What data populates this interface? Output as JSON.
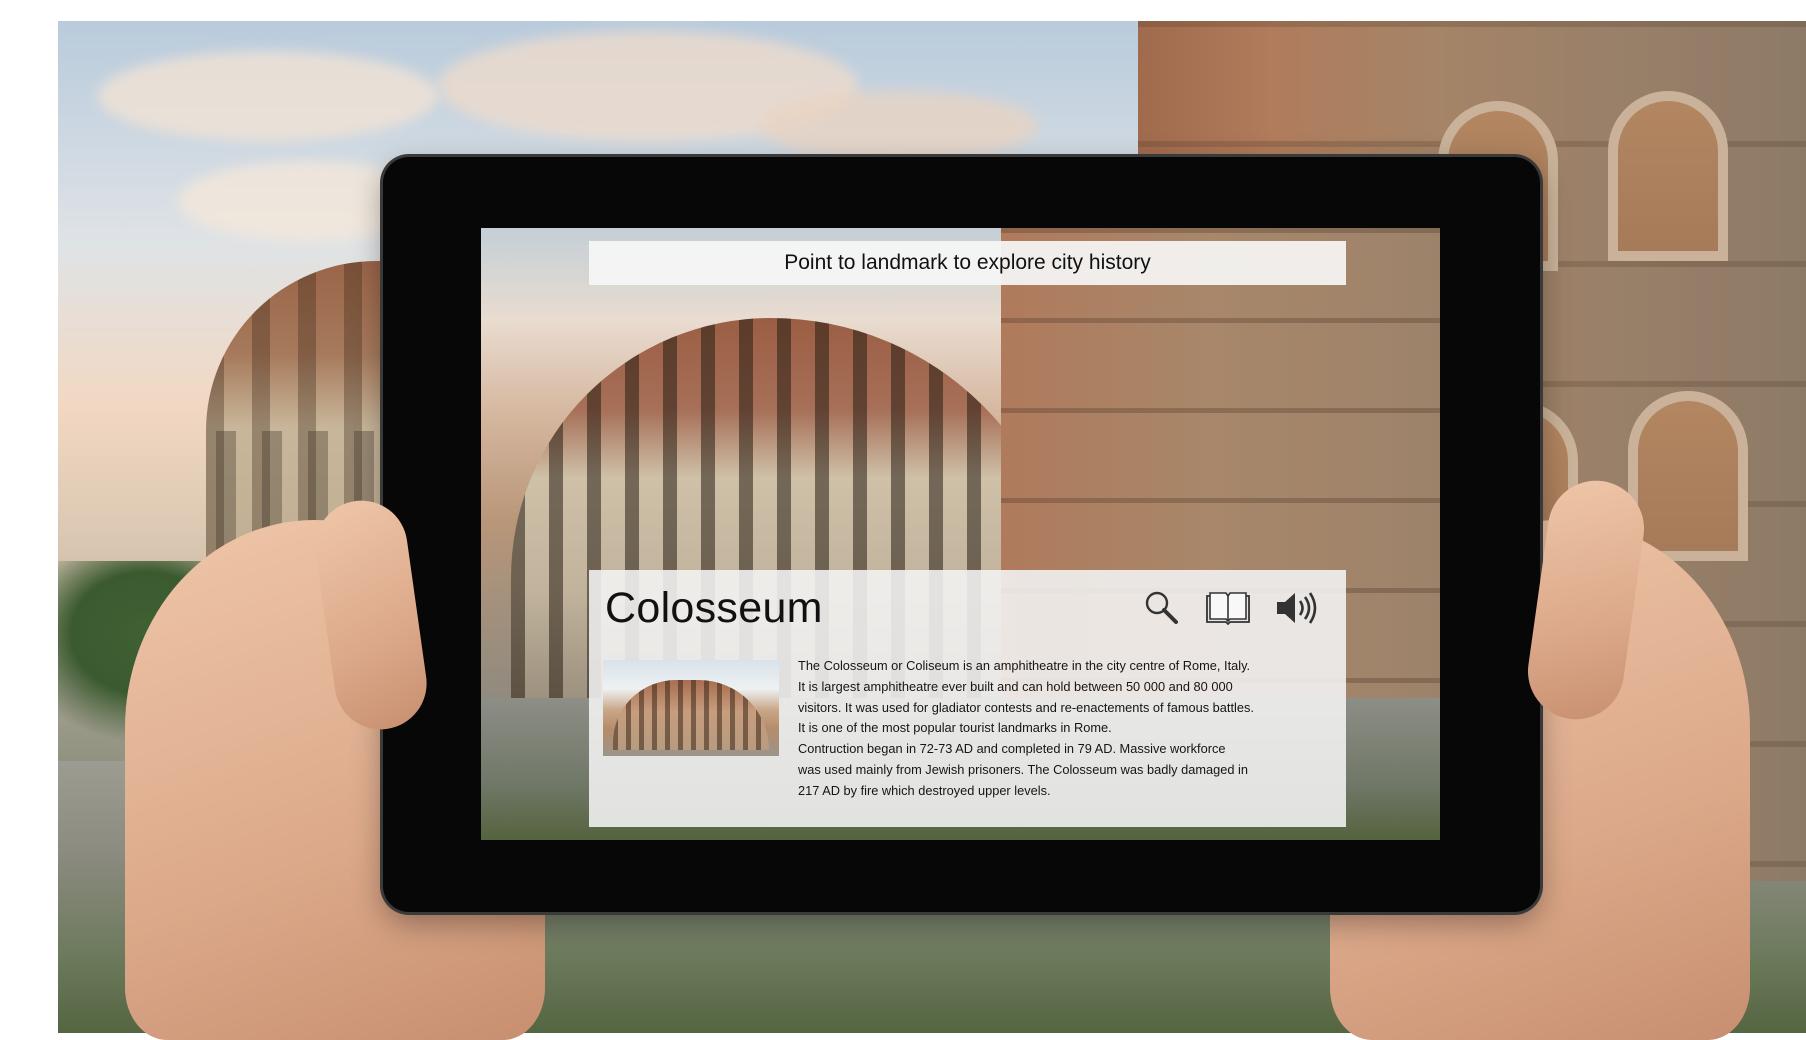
{
  "prompt_text": "Point to landmark to explore city history",
  "landmark": {
    "title": "Colosseum",
    "description_lines": [
      "The Colosseum or Coliseum is an amphitheatre in the city centre of Rome, Italy.",
      "It is largest amphitheatre ever built and can hold between 50 000 and 80 000",
      "visitors. It was used for gladiator contests and re-enactements of famous battles.",
      "It is one of the most popular tourist landmarks in Rome.",
      "Contruction began in 72-73 AD and completed in 79 AD. Massive workforce",
      "was used mainly from Jewish prisoners. The Colosseum was badly damaged in",
      "217 AD by fire which destroyed upper levels."
    ]
  },
  "icons": {
    "search": "search-icon",
    "book": "book-icon",
    "audio": "speaker-icon"
  },
  "colors": {
    "tablet_bezel": "#070707",
    "panel_bg": "#f4f4f4",
    "text": "#111111"
  }
}
